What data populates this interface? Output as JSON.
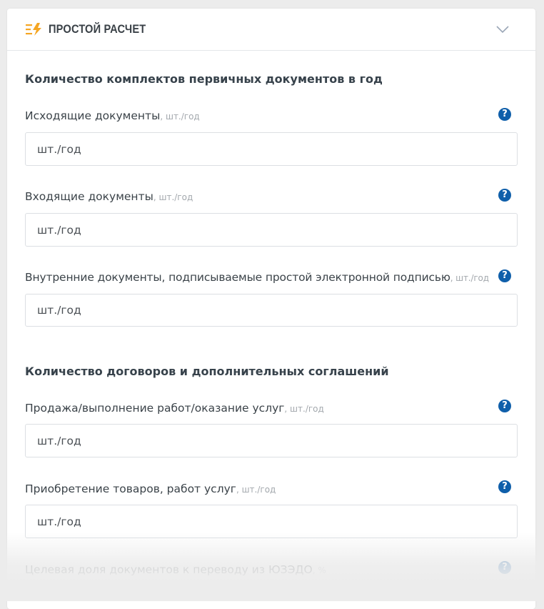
{
  "header": {
    "title": "ПРОСТОЙ РАСЧЕТ",
    "icon": "lightning-icon",
    "accent_color": "#f5a623",
    "chevron": "chevron-down-icon"
  },
  "sections": [
    {
      "title": "Количество комплектов первичных документов в год",
      "fields": [
        {
          "label": "Исходящие документы",
          "unit": ", шт./год",
          "placeholder": "шт./год"
        },
        {
          "label": "Входящие документы",
          "unit": ", шт./год",
          "placeholder": "шт./год"
        },
        {
          "label": "Внутренние документы, подписываемые простой электронной подписью",
          "unit": ", шт./год",
          "placeholder": "шт./год"
        }
      ]
    },
    {
      "title": "Количество договоров и дополнительных соглашений",
      "fields": [
        {
          "label": "Продажа/выполнение работ/оказание услуг",
          "unit": ", шт./год",
          "placeholder": "шт./год"
        },
        {
          "label": "Приобретение товаров, работ услуг",
          "unit": ", шт./год",
          "placeholder": "шт./год"
        },
        {
          "label": "Целевая доля документов к переводу из ЮЗЭДО",
          "unit": ", %",
          "placeholder": ""
        }
      ]
    }
  ],
  "help_glyph": "?",
  "help_color": "#0f5faa"
}
